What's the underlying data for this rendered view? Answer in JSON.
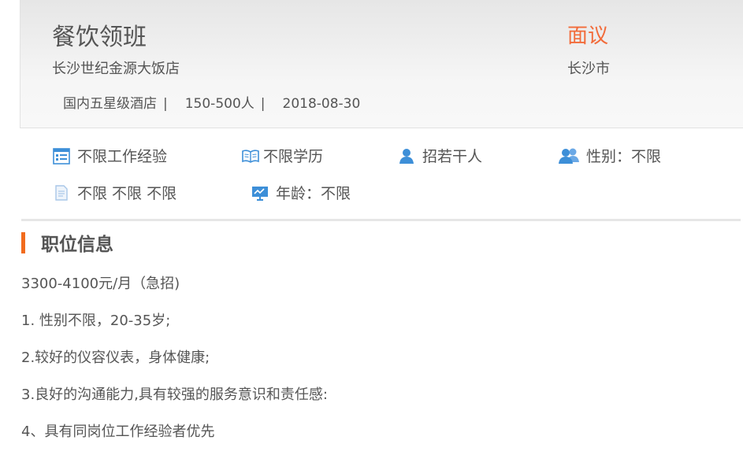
{
  "job": {
    "title": "餐饮领班",
    "company": "长沙世纪金源大饭店",
    "industry": "国内五星级酒店",
    "separator": "|",
    "size": "150-500人",
    "date": "2018-08-30",
    "salary": "面议",
    "city": "长沙市"
  },
  "requirements": [
    {
      "icon": "calendar-icon",
      "label": "不限工作经验"
    },
    {
      "icon": "book-icon",
      "label": "不限学历"
    },
    {
      "icon": "person-icon",
      "label": "招若干人"
    },
    {
      "icon": "people-icon",
      "label": "性别：不限"
    },
    {
      "icon": "document-icon",
      "label": "不限 不限 不限"
    },
    {
      "icon": "presentation-icon",
      "label": "年龄：不限"
    }
  ],
  "section": {
    "title": "职位信息"
  },
  "description": [
    "3300-4100元/月（急招)",
    "1. 性别不限，20-35岁;",
    "2.较好的仪容仪表，身体健康;",
    "3.良好的沟通能力,具有较强的服务意识和责任感:",
    "4、具有同岗位工作经验者优先"
  ],
  "colors": {
    "accent": "#f26b3a",
    "icon_blue": "#3d8fd8",
    "text": "#555555"
  }
}
